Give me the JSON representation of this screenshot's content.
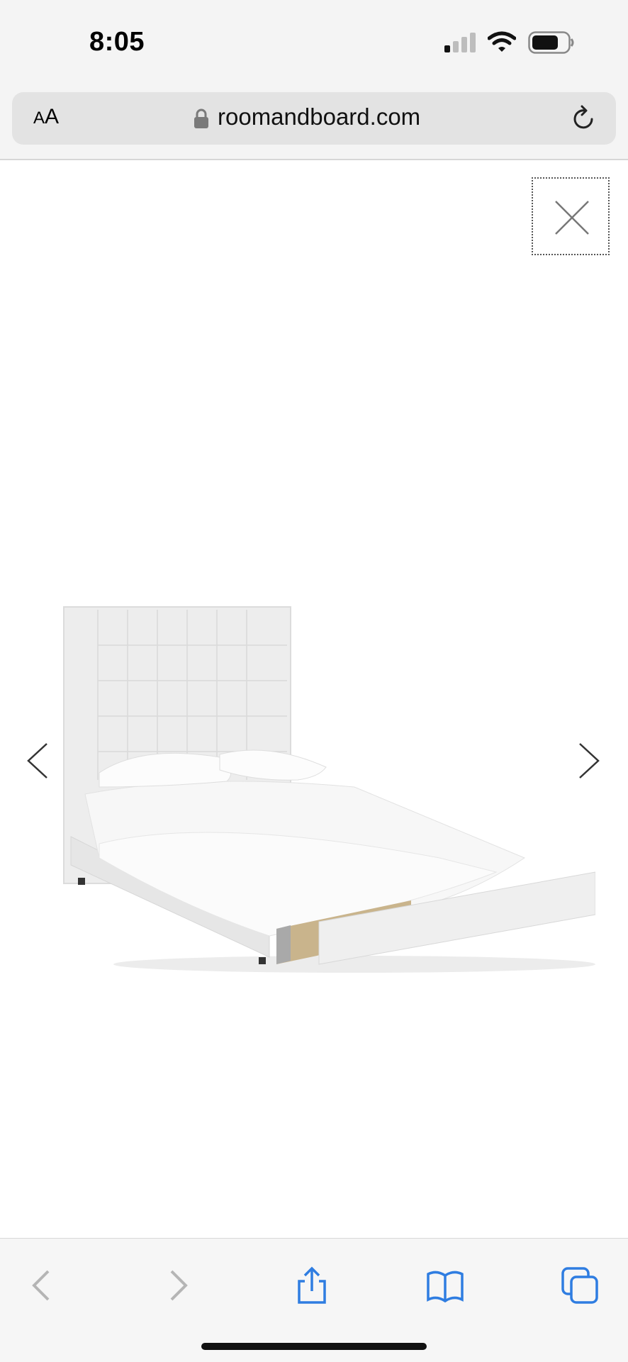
{
  "status_bar": {
    "time": "8:05"
  },
  "browser": {
    "text_size_small": "A",
    "text_size_large": "A",
    "domain": "roomandboard.com"
  },
  "gallery": {
    "image_subject": "upholstered bed with tall tufted headboard and storage drawer"
  },
  "icons": {
    "signal": "cellular-signal-icon",
    "wifi": "wifi-icon",
    "battery": "battery-icon",
    "lock": "lock-icon",
    "reload": "reload-icon",
    "close": "close-icon",
    "prev": "chevron-left-icon",
    "next": "chevron-right-icon",
    "share": "share-icon",
    "bookmarks": "bookmarks-icon",
    "tabs": "tabs-icon"
  },
  "colors": {
    "accent": "#2f7de1",
    "disabled": "#b5b5b5",
    "chrome_bg": "#f4f4f4"
  }
}
